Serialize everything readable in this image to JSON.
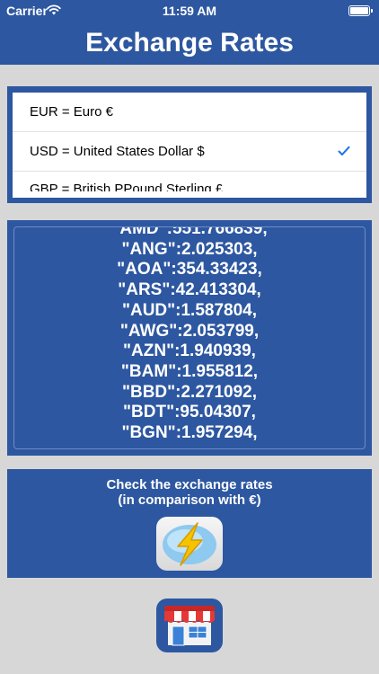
{
  "status_bar": {
    "carrier": "Carrier",
    "time": "11:59 AM",
    "wifi_icon": "wifi-icon",
    "battery_icon": "battery-icon"
  },
  "header": {
    "title": "Exchange Rates"
  },
  "currency_picker": {
    "options": [
      {
        "label": "EUR = Euro €",
        "selected": false
      },
      {
        "label": "USD = United States Dollar $",
        "selected": true
      },
      {
        "label": "GBP = British PPound Sterling £",
        "selected": false
      }
    ],
    "check_icon": "checkmark-icon"
  },
  "rates": {
    "lines": [
      "\"AMD\":551.766839,",
      "\"ANG\":2.025303,",
      "\"AOA\":354.33423,",
      "\"ARS\":42.413304,",
      "\"AUD\":1.587804,",
      "\"AWG\":2.053799,",
      "\"AZN\":1.940939,",
      "\"BAM\":1.955812,",
      "\"BBD\":2.271092,",
      "\"BDT\":95.04307,",
      "\"BGN\":1.957294,"
    ]
  },
  "check_section": {
    "line1": "Check the exchange rates",
    "line2": "(in comparison with €)",
    "button_icon": "lightning-icon"
  },
  "bottom_bar": {
    "button_icon": "store-icon"
  },
  "colors": {
    "brand_blue": "#2d57a0",
    "background_gray": "#d7d7d7",
    "checkmark_blue": "#1a73e8",
    "lightning_yellow": "#f5c400"
  }
}
